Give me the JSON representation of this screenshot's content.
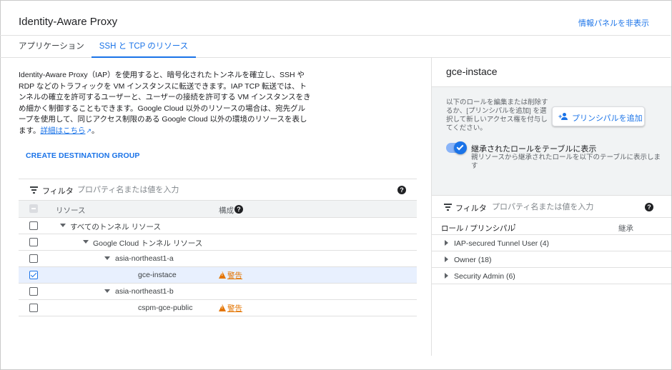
{
  "header": {
    "title": "Identity-Aware Proxy",
    "hide_info_panel": "情報パネルを非表示"
  },
  "tabs": [
    {
      "label": "アプリケーション",
      "active": false
    },
    {
      "label": "SSH と TCP のリソース",
      "active": true
    }
  ],
  "description": {
    "text": "Identity-Aware Proxy（IAP）を使用すると、暗号化されたトンネルを確立し、SSH や RDP などのトラフィックを VM インスタンスに転送できます。IAP TCP 転送では、トンネルの確立を許可するユーザーと、ユーザーの接続を許可する VM インスタンスをきめ細かく制御することもできます。Google Cloud 以外のリソースの場合は、宛先グループを使用して、同じアクセス制限のある Google Cloud 以外の環境のリソースを表します。",
    "link": "詳細はこちら",
    "suffix": "。"
  },
  "create_destination_group": "CREATE DESTINATION GROUP",
  "filter": {
    "label": "フィルタ",
    "placeholder": "プロパティ名または値を入力"
  },
  "table": {
    "columns": {
      "resource": "リソース",
      "config": "構成"
    },
    "rows": [
      {
        "label": "すべてのトンネル リソース",
        "level": 0,
        "expandable": true,
        "checked": false,
        "warning": null
      },
      {
        "label": "Google Cloud トンネル リソース",
        "level": 1,
        "expandable": true,
        "checked": false,
        "warning": null
      },
      {
        "label": "asia-northeast1-a",
        "level": 2,
        "expandable": true,
        "checked": false,
        "warning": null
      },
      {
        "label": "gce-instace",
        "level": 3,
        "expandable": false,
        "checked": true,
        "warning": "警告"
      },
      {
        "label": "asia-northeast1-b",
        "level": 2,
        "expandable": true,
        "checked": false,
        "warning": null
      },
      {
        "label": "cspm-gce-public",
        "level": 3,
        "expandable": false,
        "checked": false,
        "warning": "警告"
      }
    ]
  },
  "info_panel": {
    "title": "gce-instace",
    "note": "以下のロールを編集または削除するか、[プリンシパルを追加] を選択して新しいアクセス権を付与してください。",
    "add_principal": "プリンシパルを追加",
    "inherited_toggle": {
      "title": "継承されたロールをテーブルに表示",
      "description": "親リソースから継承されたロールを以下のテーブルに表示します",
      "on": true
    },
    "filter": {
      "label": "フィルタ",
      "placeholder": "プロパティ名または値を入力"
    },
    "columns": {
      "role": "ロール / プリンシパル",
      "inherited": "継承"
    },
    "roles": [
      {
        "label": "IAP-secured Tunnel User (4)"
      },
      {
        "label": "Owner (18)"
      },
      {
        "label": "Security Admin (6)"
      }
    ]
  },
  "colors": {
    "accent": "#1a73e8",
    "warning": "#e37400",
    "panel_bg": "#f1f3f4"
  }
}
